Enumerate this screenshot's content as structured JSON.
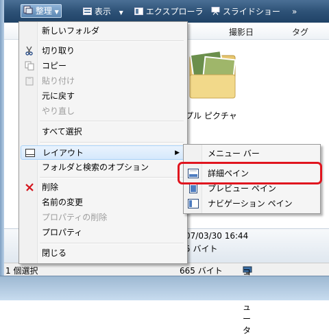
{
  "toolbar": {
    "organize": "整理",
    "view": "表示",
    "explorer": "エクスプローラ",
    "slideshow": "スライドショー",
    "more": "»"
  },
  "columns": {
    "date_taken": "撮影日",
    "tags": "タグ"
  },
  "file": {
    "caption": "プル ピクチャ"
  },
  "details": {
    "date": "07/03/30 16:44",
    "size": "5 バイト"
  },
  "status": {
    "selected": "1 個選択",
    "size": "665 バイト",
    "location": "コンピュータ"
  },
  "menu": {
    "new_folder": "新しいフォルダ",
    "cut": "切り取り",
    "copy": "コピー",
    "paste": "貼り付け",
    "undo": "元に戻す",
    "redo": "やり直し",
    "select_all": "すべて選択",
    "layout": "レイアウト",
    "folder_options": "フォルダと検索のオプション",
    "delete": "削除",
    "rename": "名前の変更",
    "remove_properties": "プロパティの削除",
    "properties": "プロパティ",
    "close": "閉じる"
  },
  "submenu": {
    "menu_bar": "メニュー バー",
    "details_pane": "詳細ペイン",
    "preview_pane": "プレビュー ペイン",
    "navigation_pane": "ナビゲーション ペイン"
  },
  "colors": {
    "highlight_border": "#e0141e",
    "toolbar": "#2e5277"
  }
}
